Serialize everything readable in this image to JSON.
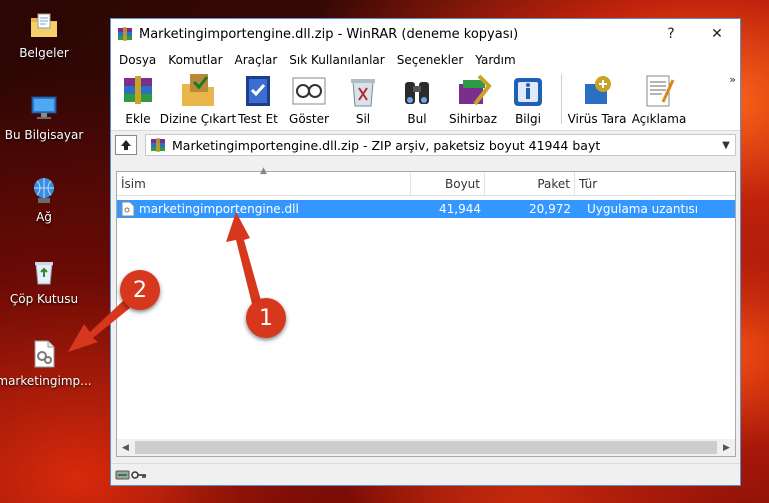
{
  "desktop": {
    "icons": [
      {
        "label": "Belgeler",
        "icon": "folder-documents-icon"
      },
      {
        "label": "Bu Bilgisayar",
        "icon": "computer-icon"
      },
      {
        "label": "Ağ",
        "icon": "network-icon"
      },
      {
        "label": "Çöp Kutusu",
        "icon": "recycle-bin-icon"
      },
      {
        "label": "marketingimp...",
        "icon": "dll-file-icon"
      }
    ]
  },
  "window": {
    "title": "Marketingimportengine.dll.zip - WinRAR (deneme kopyası)",
    "help_btn": "?",
    "close_btn": "✕",
    "menu": [
      "Dosya",
      "Komutlar",
      "Araçlar",
      "Sık Kullanılanlar",
      "Seçenekler",
      "Yardım"
    ],
    "toolbar": [
      {
        "label": "Ekle",
        "icon": "add-archive-icon"
      },
      {
        "label": "Dizine Çıkart",
        "icon": "extract-to-icon"
      },
      {
        "label": "Test Et",
        "icon": "test-icon"
      },
      {
        "label": "Göster",
        "icon": "view-icon"
      },
      {
        "label": "Sil",
        "icon": "delete-icon"
      },
      {
        "label": "Bul",
        "icon": "find-icon"
      },
      {
        "label": "Sihirbaz",
        "icon": "wizard-icon"
      },
      {
        "label": "Bilgi",
        "icon": "info-icon"
      },
      {
        "label": "Virüs Tara",
        "icon": "virus-scan-icon"
      },
      {
        "label": "Açıklama",
        "icon": "comment-icon"
      }
    ],
    "more_chevron": "»",
    "path": "Marketingimportengine.dll.zip - ZIP arşiv, paketsiz boyut 41944 bayt",
    "columns": {
      "name": "İsim",
      "size": "Boyut",
      "packed": "Paket",
      "type": "Tür"
    },
    "files": [
      {
        "name": "marketingimportengine.dll",
        "size": "41,944",
        "packed": "20,972",
        "type": "Uygulama uzantısı",
        "selected": true
      }
    ]
  },
  "annotations": {
    "badge_1": "1",
    "badge_2": "2",
    "color": "#d6371d"
  }
}
